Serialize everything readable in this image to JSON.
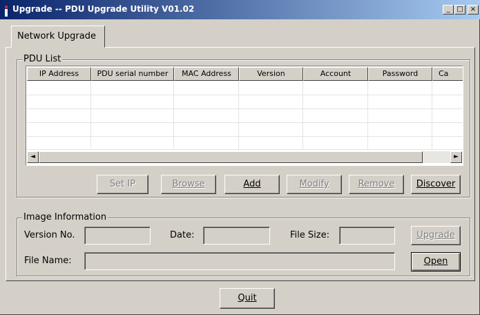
{
  "window": {
    "title": "Upgrade -- PDU Upgrade Utility V01.02",
    "minimize_glyph": "_",
    "maximize_glyph": "□",
    "close_glyph": "×"
  },
  "tab": {
    "label": "Network Upgrade"
  },
  "pdu_list": {
    "legend": "PDU List",
    "columns": [
      "IP Address",
      "PDU serial number",
      "MAC Address",
      "Version",
      "Account",
      "Password",
      "Ca"
    ],
    "rows": [],
    "scroll_left_glyph": "◄",
    "scroll_right_glyph": "►"
  },
  "list_buttons": {
    "set_ip": "Set IP",
    "browse": "Browse",
    "add": "Add",
    "modify": "Modify",
    "remove": "Remove",
    "discover": "Discover"
  },
  "image_info": {
    "legend": "Image Information",
    "version_label": "Version No.",
    "date_label": "Date:",
    "filesize_label": "File Size:",
    "filename_label": "File Name:",
    "version_value": "",
    "date_value": "",
    "filesize_value": "",
    "filename_value": "",
    "upgrade_label": "Upgrade",
    "open_label": "Open"
  },
  "footer": {
    "quit_label": "Quit"
  }
}
